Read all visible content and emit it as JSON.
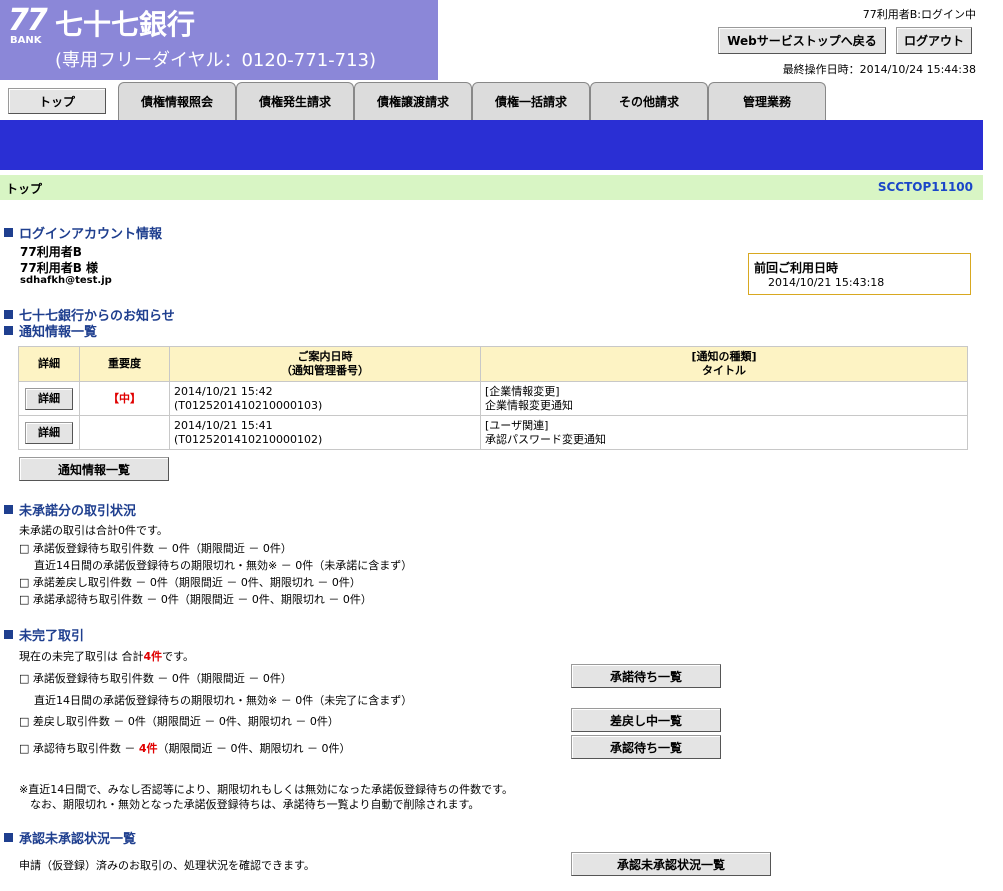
{
  "header": {
    "logo_number": "77",
    "logo_bank": "BANK",
    "bank_name": "七十七銀行",
    "toll_free": "(専用フリーダイヤル：0120-771-713)",
    "user_status": "77利用者B:ログイン中",
    "websvc_button": "Webサービストップへ戻る",
    "logout_button": "ログアウト",
    "last_operation": "最終操作日時：2014/10/24 15:44:38"
  },
  "tabs": {
    "top": "トップ",
    "items": [
      "債権情報照会",
      "債権発生請求",
      "債権譲渡請求",
      "債権一括請求",
      "その他請求",
      "管理業務"
    ]
  },
  "breadcrumb": {
    "title": "トップ",
    "screen_id": "SCCTOP11100"
  },
  "login_info": {
    "heading": "ログインアカウント情報",
    "user1": "77利用者B",
    "user2": "77利用者B 様",
    "email": "sdhafkh@test.jp",
    "last_use_label": "前回ご利用日時",
    "last_use_value": "2014/10/21 15:43:18"
  },
  "notices": {
    "heading1": "七十七銀行からのお知らせ",
    "heading2": "通知情報一覧",
    "columns": {
      "detail": "詳細",
      "importance": "重要度",
      "date_line1": "ご案内日時",
      "date_line2": "（通知管理番号）",
      "type_line1": "[通知の種類]",
      "type_line2": "タイトル"
    },
    "rows": [
      {
        "button": "詳細",
        "importance": "【中】",
        "date": "2014/10/21 15:42",
        "number": "(T0125201410210000103)",
        "type": "[企業情報変更]",
        "title": "企業情報変更通知"
      },
      {
        "button": "詳細",
        "importance": "",
        "date": "2014/10/21 15:41",
        "number": "(T0125201410210000102)",
        "type": "[ユーザ関連]",
        "title": "承認パスワード変更通知"
      }
    ],
    "list_button": "通知情報一覧"
  },
  "unapproved": {
    "heading": "未承諾分の取引状況",
    "summary": "未承諾の取引は合計0件です。",
    "line1": "□ 承諾仮登録待ち取引件数 － 0件（期限間近 － 0件）",
    "line2": "直近14日間の承諾仮登録待ちの期限切れ・無効※ － 0件（未承諾に含まず）",
    "line3": "□ 承諾差戻し取引件数 － 0件（期限間近 － 0件、期限切れ － 0件）",
    "line4": "□ 承諾承認待ち取引件数 － 0件（期限間近 － 0件、期限切れ － 0件）"
  },
  "incomplete": {
    "heading": "未完了取引",
    "summary_pre": "現在の未完了取引は 合計",
    "summary_count": "4件",
    "summary_post": "です。",
    "line1": "□ 承諾仮登録待ち取引件数 － 0件（期限間近 － 0件）",
    "line2": "直近14日間の承諾仮登録待ちの期限切れ・無効※ － 0件（未完了に含まず）",
    "line3": "□ 差戻し取引件数 － 0件（期限間近 － 0件、期限切れ － 0件）",
    "line4_pre": "□ 承認待ち取引件数 － ",
    "line4_count": "4件",
    "line4_post": "（期限間近 － 0件、期限切れ － 0件）",
    "btn_approval_wait": "承諾待ち一覧",
    "btn_remand": "差戻し中一覧",
    "btn_approve_wait": "承認待ち一覧",
    "note1": "※直近14日間で、みなし否認等により、期限切れもしくは無効になった承諾仮登録待ちの件数です。",
    "note2": "なお、期限切れ・無効となった承諾仮登録待ちは、承諾待ち一覧より自動で削除されます。"
  },
  "approval_status": {
    "heading": "承認未承認状況一覧",
    "text": "申請（仮登録）済みのお取引の、処理状況を確認できます。",
    "button": "承認未承認状況一覧"
  },
  "colors": {
    "logo_bg": "#8b87d8",
    "blue_bar": "#2a2fd4",
    "crumb_bg": "#d8f5c4",
    "heading": "#1f3f8f",
    "alert": "#e00000"
  }
}
